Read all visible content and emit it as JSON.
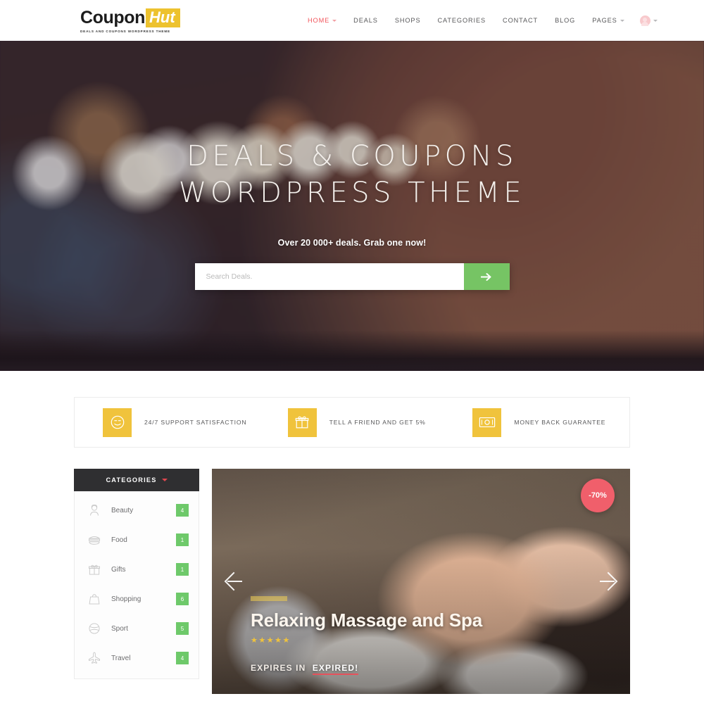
{
  "header": {
    "logo": {
      "main": "Coupon",
      "accent": "Hut",
      "tagline": "DEALS AND COUPONS WORDPRESS THEME"
    },
    "nav": [
      {
        "label": "HOME",
        "active": true,
        "caret": true
      },
      {
        "label": "DEALS",
        "active": false,
        "caret": false
      },
      {
        "label": "SHOPS",
        "active": false,
        "caret": false
      },
      {
        "label": "CATEGORIES",
        "active": false,
        "caret": false
      },
      {
        "label": "CONTACT",
        "active": false,
        "caret": false
      },
      {
        "label": "BLOG",
        "active": false,
        "caret": false
      },
      {
        "label": "PAGES",
        "active": false,
        "caret": true
      }
    ],
    "account_icon": "user-account-icon",
    "accent_color": "#f2545b"
  },
  "hero": {
    "title_line1": "DEALS & COUPONS",
    "title_line2": "WORDPRESS THEME",
    "subtitle": "Over 20 000+ deals. Grab one now!",
    "search": {
      "value": "",
      "placeholder": "Search Deals.",
      "button_icon": "arrow-right-icon",
      "button_color": "#76c464"
    }
  },
  "features": [
    {
      "icon": "smiley-face-icon",
      "label": "24/7 SUPPORT SATISFACTION"
    },
    {
      "icon": "gift-box-icon",
      "label": "TELL A FRIEND AND GET 5%"
    },
    {
      "icon": "banknote-icon",
      "label": "MONEY BACK GUARANTEE"
    }
  ],
  "sidebar": {
    "title": "CATEGORIES",
    "caret_color": "#e0474f",
    "items": [
      {
        "icon": "beauty-woman-icon",
        "label": "Beauty",
        "count": "4"
      },
      {
        "icon": "food-burger-icon",
        "label": "Food",
        "count": "1"
      },
      {
        "icon": "gift-box-icon",
        "label": "Gifts",
        "count": "1"
      },
      {
        "icon": "shopping-bag-icon",
        "label": "Shopping",
        "count": "6"
      },
      {
        "icon": "sport-ball-icon",
        "label": "Sport",
        "count": "5"
      },
      {
        "icon": "travel-plane-icon",
        "label": "Travel",
        "count": "4"
      }
    ],
    "count_color": "#6ec96a"
  },
  "deal": {
    "discount": "-70%",
    "discount_color": "#f05f6b",
    "title": "Relaxing Massage and Spa",
    "stars": "★★★★★",
    "expires_label": "EXPIRES IN",
    "expired_text": "EXPIRED!",
    "prev_icon": "arrow-left-icon",
    "next_icon": "arrow-right-icon"
  }
}
